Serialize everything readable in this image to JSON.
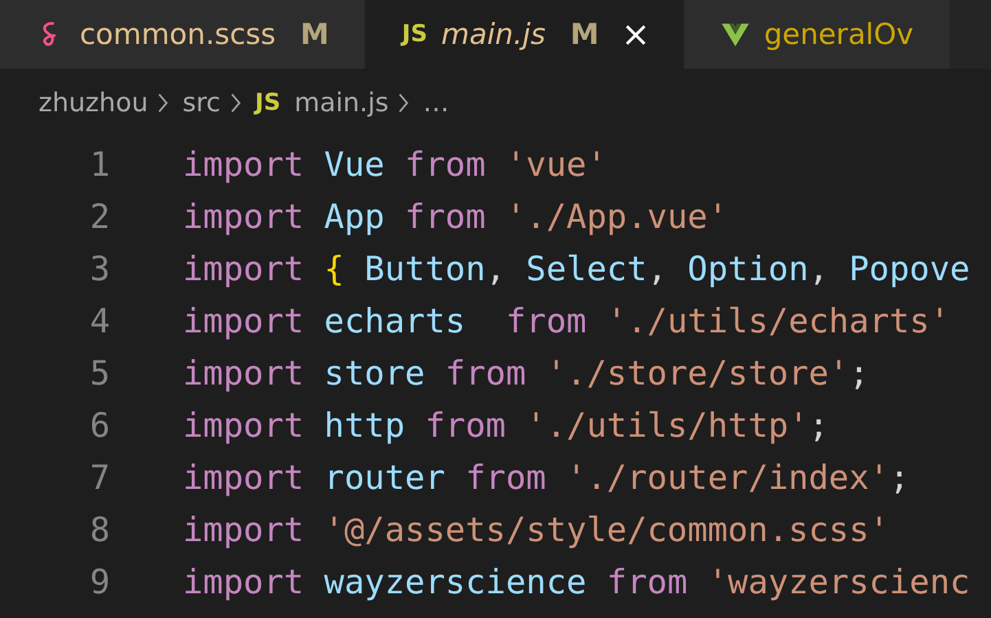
{
  "tabs": [
    {
      "label": "common.scss",
      "icon": {
        "kind": "sass"
      },
      "badge": "M",
      "selected": false,
      "preview": false,
      "color": "#e2c08d"
    },
    {
      "label": "main.js",
      "icon": {
        "kind": "js",
        "text": "JS"
      },
      "badge": "M",
      "selected": true,
      "preview": true,
      "color": "#e2c08d"
    },
    {
      "label": "generalOv",
      "icon": {
        "kind": "vue"
      },
      "selected": false,
      "preview": false,
      "color": "#cca700"
    }
  ],
  "breadcrumb": [
    {
      "kind": "folder",
      "label": "zhuzhou"
    },
    {
      "kind": "folder",
      "label": "src"
    },
    {
      "kind": "file",
      "icon_text": "JS",
      "label": "main.js"
    },
    {
      "kind": "more",
      "label": "…"
    }
  ],
  "code": [
    {
      "number": "1",
      "tokens": [
        {
          "kind": "keyword",
          "text": "import "
        },
        {
          "kind": "ident",
          "text": "Vue "
        },
        {
          "kind": "keyword",
          "text": "from "
        },
        {
          "kind": "string",
          "text": "'vue'"
        }
      ]
    },
    {
      "number": "2",
      "tokens": [
        {
          "kind": "keyword",
          "text": "import "
        },
        {
          "kind": "ident",
          "text": "App "
        },
        {
          "kind": "keyword",
          "text": "from "
        },
        {
          "kind": "string",
          "text": "'./App.vue'"
        }
      ]
    },
    {
      "number": "3",
      "tokens": [
        {
          "kind": "keyword",
          "text": "import "
        },
        {
          "kind": "brace",
          "text": "{ "
        },
        {
          "kind": "ident",
          "text": "Button"
        },
        {
          "kind": "plain",
          "text": ", "
        },
        {
          "kind": "ident",
          "text": "Select"
        },
        {
          "kind": "plain",
          "text": ", "
        },
        {
          "kind": "ident",
          "text": "Option"
        },
        {
          "kind": "plain",
          "text": ", "
        },
        {
          "kind": "ident",
          "text": "Popove"
        }
      ]
    },
    {
      "number": "4",
      "tokens": [
        {
          "kind": "keyword",
          "text": "import "
        },
        {
          "kind": "ident",
          "text": "echarts  "
        },
        {
          "kind": "keyword",
          "text": "from "
        },
        {
          "kind": "string",
          "text": "'./utils/echarts'"
        }
      ]
    },
    {
      "number": "5",
      "tokens": [
        {
          "kind": "keyword",
          "text": "import "
        },
        {
          "kind": "ident",
          "text": "store "
        },
        {
          "kind": "keyword",
          "text": "from "
        },
        {
          "kind": "string",
          "text": "'./store/store'"
        },
        {
          "kind": "plain",
          "text": ";"
        }
      ]
    },
    {
      "number": "6",
      "tokens": [
        {
          "kind": "keyword",
          "text": "import "
        },
        {
          "kind": "ident",
          "text": "http "
        },
        {
          "kind": "keyword",
          "text": "from "
        },
        {
          "kind": "string",
          "text": "'./utils/http'"
        },
        {
          "kind": "plain",
          "text": ";"
        }
      ]
    },
    {
      "number": "7",
      "tokens": [
        {
          "kind": "keyword",
          "text": "import "
        },
        {
          "kind": "ident",
          "text": "router "
        },
        {
          "kind": "keyword",
          "text": "from "
        },
        {
          "kind": "string",
          "text": "'./router/index'"
        },
        {
          "kind": "plain",
          "text": ";"
        }
      ]
    },
    {
      "number": "8",
      "tokens": [
        {
          "kind": "keyword",
          "text": "import "
        },
        {
          "kind": "string",
          "text": "'@/assets/style/common.scss'"
        }
      ]
    },
    {
      "number": "9",
      "tokens": [
        {
          "kind": "keyword",
          "text": "import "
        },
        {
          "kind": "ident",
          "text": "wayzerscience "
        },
        {
          "kind": "keyword",
          "text": "from "
        },
        {
          "kind": "string",
          "text": "'wayzerscienc"
        }
      ]
    }
  ]
}
